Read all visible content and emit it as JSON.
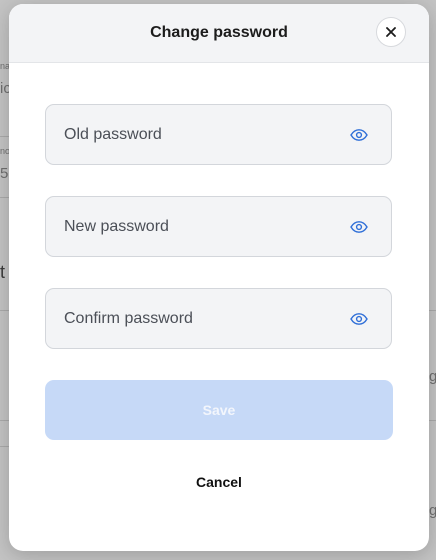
{
  "background": {
    "masked_value": "***********",
    "frag_small_1": "na",
    "frag_big_1": "ic",
    "frag_small_2": "no",
    "frag_big_2": "5",
    "frag_t": "t",
    "frag_g1": "g",
    "frag_g2": "g"
  },
  "modal": {
    "title": "Change password",
    "close_icon": "close-icon",
    "fields": [
      {
        "placeholder": "Old password",
        "value": "",
        "icon": "eye-icon"
      },
      {
        "placeholder": "New password",
        "value": "",
        "icon": "eye-icon"
      },
      {
        "placeholder": "Confirm password",
        "value": "",
        "icon": "eye-icon"
      }
    ],
    "save_label": "Save",
    "cancel_label": "Cancel"
  },
  "colors": {
    "accent": "#2f6fd8",
    "save_disabled_bg": "#c6d9f7",
    "overlay": "#c4c4c4"
  }
}
